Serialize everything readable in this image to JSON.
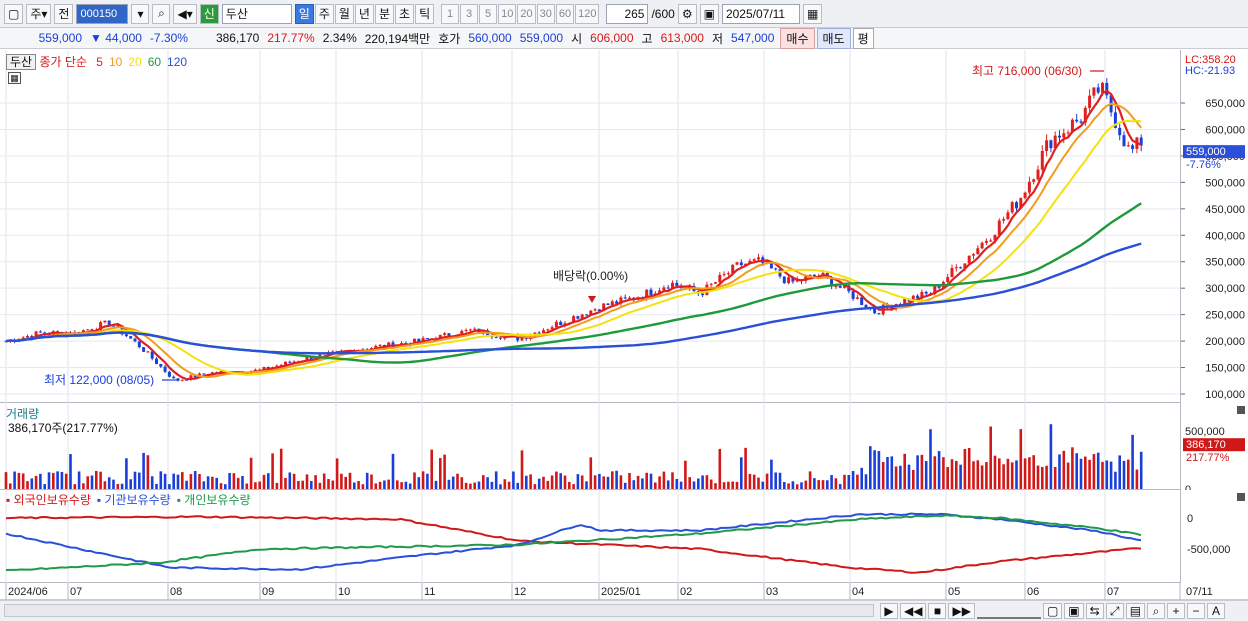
{
  "toolbar": {
    "market": "주",
    "prev_label": "전",
    "code": "000150",
    "badge": "신",
    "name": "두산",
    "periods": [
      "일",
      "주",
      "월",
      "년",
      "분",
      "초",
      "틱"
    ],
    "selected_period": "일",
    "minutes": [
      "1",
      "3",
      "5",
      "10",
      "20",
      "30",
      "60",
      "120"
    ],
    "count": "265",
    "count_max": "/600",
    "date": "2025/07/11"
  },
  "info": {
    "price": "559,000",
    "change": "▼ 44,000",
    "change_pct": "-7.30%",
    "volume": "386,170",
    "volume_pct": "217.77%",
    "turnover_pct": "2.34%",
    "amount": "220,194백만",
    "bid_label": "호가",
    "ask": "560,000",
    "bid": "559,000",
    "open_label": "시",
    "open": "606,000",
    "high_label": "고",
    "high": "613,000",
    "low_label": "저",
    "low": "547,000",
    "buy_label": "매수",
    "sell_label": "매도",
    "flat_label": "평"
  },
  "price_pane": {
    "name_tag": "두산",
    "ma_title": "종가 단순",
    "ma_periods": [
      "5",
      "10",
      "20",
      "60",
      "120"
    ],
    "ma_colors": [
      "#e02020",
      "#f39c1a",
      "#f5e10c",
      "#1e9a3a",
      "#2a4fd8"
    ],
    "lc": "LC:358.20",
    "hc": "HC:-21.93",
    "current_price": "559,000",
    "current_pct": "-7.76%",
    "high_note": "최고 716,000 (06/30)",
    "low_note": "최저 122,000 (08/05)",
    "dividend_note": "배당락(0.00%)",
    "y_ticks": [
      "650,000",
      "600,000",
      "550,000",
      "500,000",
      "450,000",
      "400,000",
      "350,000",
      "300,000",
      "250,000",
      "200,000",
      "150,000",
      "100,000"
    ]
  },
  "volume_pane": {
    "title": "거래량",
    "sub": "386,170주(217.77%)",
    "y_ticks": [
      "500,000",
      "0"
    ],
    "current": "386,170",
    "current_pct": "217.77%"
  },
  "holding_pane": {
    "legends": [
      "외국인보유수량",
      "기관보유수량",
      "개인보유수량"
    ],
    "colors": [
      "#d01818",
      "#2a4fd8",
      "#1e9a4a"
    ],
    "y_ticks": [
      "0",
      "-500,000"
    ]
  },
  "x_labels": [
    "2024/06",
    "07",
    "08",
    "09",
    "10",
    "11",
    "12",
    "2025/01",
    "02",
    "03",
    "04",
    "05",
    "06",
    "07"
  ],
  "last_date": "07/11"
}
